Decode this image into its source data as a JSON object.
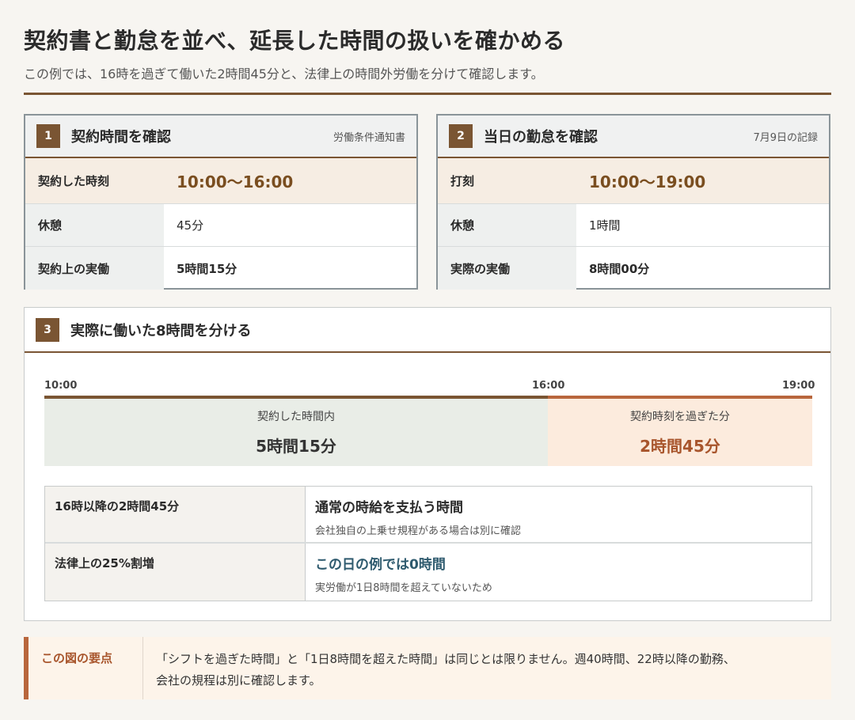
{
  "header": {
    "title": "契約書と勤怠を並べ、延長した時間の扱いを確かめる",
    "subtitle": "この例では、16時を過ぎて働いた2時間45分と、法律上の時間外労働を分けて確認します。"
  },
  "step1": {
    "num": "1",
    "title": "契約時間を確認",
    "meta": "労働条件通知書",
    "rows": [
      {
        "label": "契約した時刻",
        "value": "10:00〜16:00"
      },
      {
        "label": "休憩",
        "value": "45分"
      },
      {
        "label": "契約上の実働",
        "value": "5時間15分"
      }
    ]
  },
  "step2": {
    "num": "2",
    "title": "当日の勤怠を確認",
    "meta": "7月9日の記録",
    "rows": [
      {
        "label": "打刻",
        "value": "10:00〜19:00"
      },
      {
        "label": "休憩",
        "value": "1時間"
      },
      {
        "label": "実際の実働",
        "value": "8時間00分"
      }
    ]
  },
  "step3": {
    "num": "3",
    "title": "実際に働いた8時間を分ける",
    "timeline": {
      "ticks": [
        "10:00",
        "16:00",
        "19:00"
      ],
      "segments": [
        {
          "label": "契約した時間内",
          "value": "5時間15分",
          "hours": 5.25
        },
        {
          "label": "契約時刻を過ぎた分",
          "value": "2時間45分",
          "hours": 2.75
        }
      ]
    },
    "table": [
      {
        "left": "16時以降の2時間45分",
        "main": "通常の時給を支払う時間",
        "note": "会社独自の上乗せ規程がある場合は別に確認"
      },
      {
        "left": "法律上の25%割増",
        "main": "この日の例では0時間",
        "note": "実労働が1日8時間を超えていないため"
      }
    ]
  },
  "keypoint": {
    "label": "この図の要点",
    "line1": "「シフトを過ぎた時間」と「1日8時間を超えた時間」は同じとは限りません。週40時間、22時以降の勤務、",
    "line2": "会社の規程は別に確認します。"
  },
  "colors": {
    "accent_brown": "#7a5533",
    "accent_orange": "#b8663d",
    "highlight_blue": "#2e5a6e"
  }
}
